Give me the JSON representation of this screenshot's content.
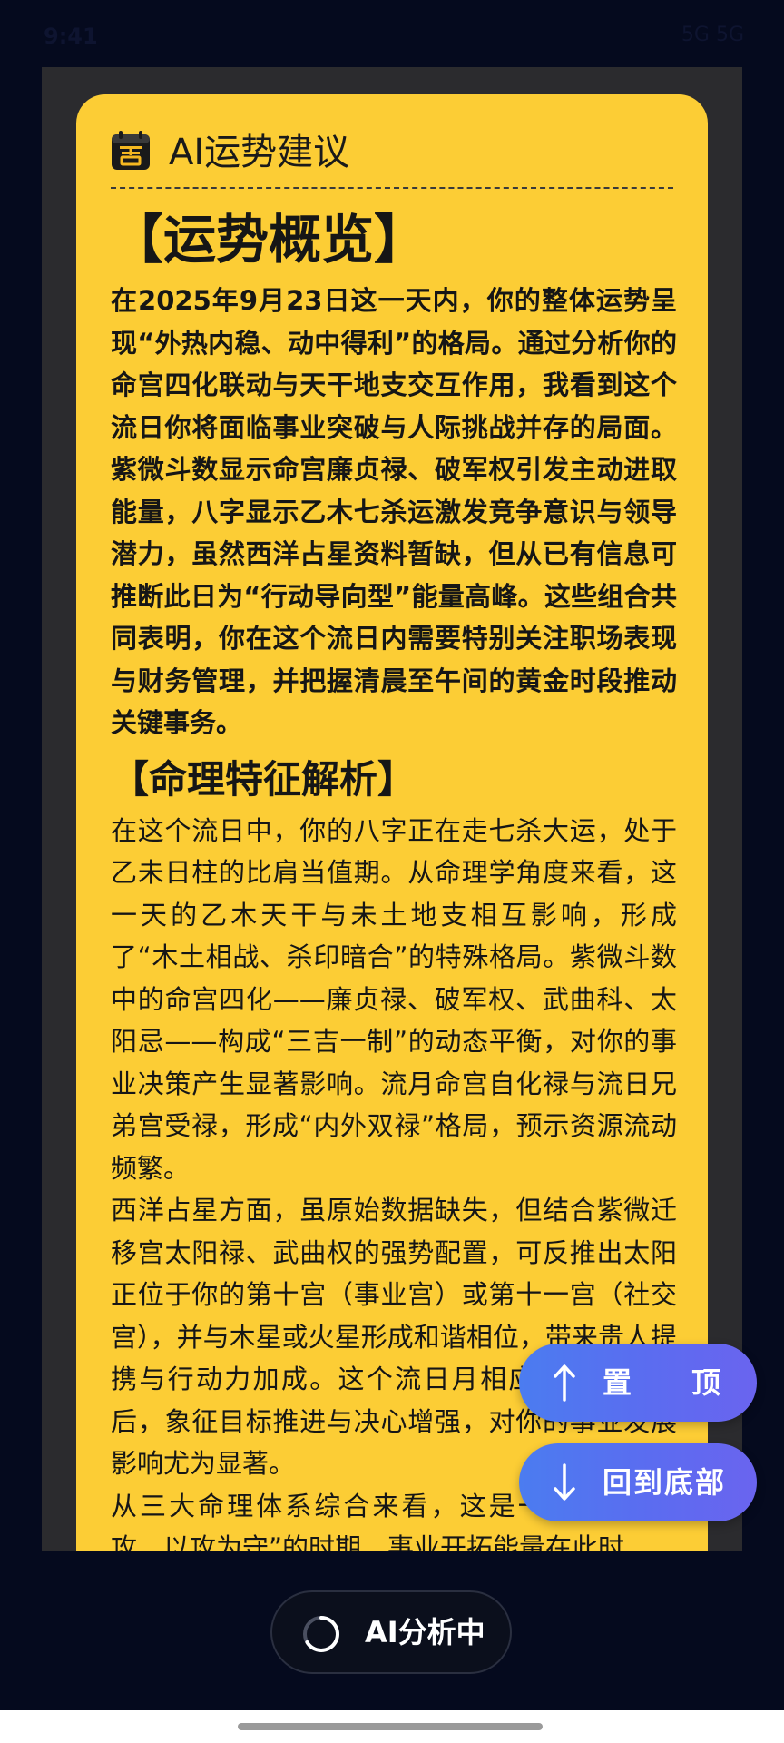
{
  "status_bar": {
    "time": "9:41",
    "right": "5G 5G"
  },
  "card": {
    "title": "AI运势建议"
  },
  "sections": {
    "overview_title": "【运势概览】",
    "overview_p1": "在2025年9月23日这一天内，你的整体运势呈现“外热内稳、动中得利”的格局。通过分析你的命宫四化联动与天干地支交互作用，我看到这个流日你将面临事业突破与人际挑战并存的局面。紫微斗数显示命宫廉贞禄、破军权引发主动进取能量，八字显示乙木七杀运激发竞争意识与领导潜力，虽然西洋占星资料暂缺，但从已有信息可推断此日为“行动导向型”能量高峰。这些组合共同表明，你在这个流日内需要特别关注职场表现与财务管理，并把握清晨至午间的黄金时段推动关键事务。",
    "traits_title": "【命理特征解析】",
    "traits_p1": "在这个流日中，你的八字正在走七杀大运，处于乙未日柱的比肩当值期。从命理学角度来看，这一天的乙木天干与未土地支相互影响，形成了“木土相战、杀印暗合”的特殊格局。紫微斗数中的命宫四化——廉贞禄、破军权、武曲科、太阳忌——构成“三吉一制”的动态平衡，对你的事业决策产生显著影响。流月命宫自化禄与流日兄弟宫受禄，形成“内外双禄”格局，预示资源流动频繁。",
    "traits_p2": "西洋占星方面，虽原始数据缺失，但结合紫微迁移宫太阳禄、武曲权的强势配置，可反推出太阳正位于你的第十宫（事业宫）或第十一宫（社交宫），并与木星或火星形成和谐相位，带来贵人提携与行动力加成。这个流日月相应为上弦月前后，象征目标推进与决心增强，对你的事业发展影响尤为显著。",
    "traits_p3": "从三大命理体系综合来看，这是一个“以守为攻，以攻为守”的时期，事业开拓能量在此时"
  },
  "buttons": {
    "top_label_a": "置",
    "top_label_b": "顶",
    "bottom_label": "回到底部",
    "analyze_label": "AI分析中"
  },
  "colors": {
    "card_bg": "#fccd35",
    "fab_gradient_start": "#4b7cf0",
    "fab_gradient_end": "#6a64ef",
    "page_bg": "#050a1e"
  }
}
